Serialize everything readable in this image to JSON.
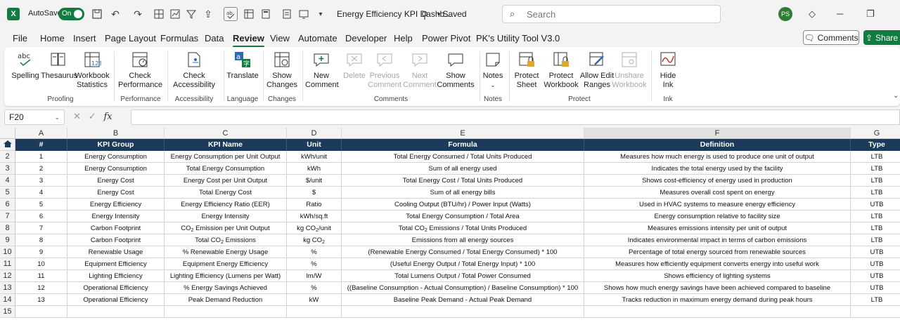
{
  "titlebar": {
    "app_logo": "X",
    "autosave_label": "AutoSave",
    "autosave_state": "On",
    "doc_title": "Energy Efficiency KPI Dashb...",
    "saved_status": "• Saved",
    "search_placeholder": "Search",
    "user_initials": "PS"
  },
  "menu": {
    "tabs": [
      "File",
      "Home",
      "Insert",
      "Page Layout",
      "Formulas",
      "Data",
      "Review",
      "View",
      "Automate",
      "Developer",
      "Help",
      "Power Pivot",
      "PK's Utility Tool V3.0"
    ],
    "active_tab": "Review",
    "comments_label": "Comments",
    "share_label": "Share"
  },
  "ribbon": {
    "buttons": [
      {
        "label": "Spelling",
        "icon": "abc-check-icon"
      },
      {
        "label": "Thesaurus",
        "icon": "book-icon"
      },
      {
        "label": "Workbook Statistics",
        "icon": "statistics-icon"
      },
      {
        "label": "Check Performance",
        "icon": "performance-icon"
      },
      {
        "label": "Check Accessibility",
        "icon": "accessibility-icon"
      },
      {
        "label": "Translate",
        "icon": "translate-icon"
      },
      {
        "label": "Show Changes",
        "icon": "show-changes-icon"
      },
      {
        "label": "New Comment",
        "icon": "new-comment-icon"
      },
      {
        "label": "Delete",
        "icon": "delete-comment-icon"
      },
      {
        "label": "Previous Comment",
        "icon": "previous-comment-icon"
      },
      {
        "label": "Next Comment",
        "icon": "next-comment-icon"
      },
      {
        "label": "Show Comments",
        "icon": "show-comments-icon"
      },
      {
        "label": "Notes",
        "icon": "notes-icon"
      },
      {
        "label": "Protect Sheet",
        "icon": "protect-sheet-icon"
      },
      {
        "label": "Protect Workbook",
        "icon": "protect-workbook-icon"
      },
      {
        "label": "Allow Edit Ranges",
        "icon": "allow-edit-icon"
      },
      {
        "label": "Unshare Workbook",
        "icon": "unshare-icon"
      },
      {
        "label": "Hide Ink",
        "icon": "ink-icon"
      }
    ],
    "groups": [
      "Proofing",
      "Performance",
      "Accessibility",
      "Language",
      "Changes",
      "Comments",
      "Notes",
      "Protect",
      "Ink"
    ]
  },
  "formula_bar": {
    "name_box": "F20",
    "fx_label": "fx",
    "formula": ""
  },
  "sheet": {
    "column_letters": [
      "A",
      "B",
      "C",
      "D",
      "E",
      "F",
      "G"
    ],
    "selected_column": "F",
    "row_numbers": [
      "1",
      "2",
      "3",
      "4",
      "5",
      "6",
      "7",
      "8",
      "9",
      "10",
      "11",
      "12",
      "13",
      "14",
      "15"
    ],
    "headers": [
      "#",
      "KPI Group",
      "KPI Name",
      "Unit",
      "Formula",
      "Definition",
      "Type"
    ],
    "rows": [
      [
        "1",
        "Energy Consumption",
        "Energy Consumption per Unit Output",
        "kWh/unit",
        "Total Energy Consumed / Total Units Produced",
        "Measures how much energy is used to produce one unit of output",
        "LTB"
      ],
      [
        "2",
        "Energy Consumption",
        "Total Energy Consumption",
        "kWh",
        "Sum of all energy used",
        "Indicates the total energy used by the facility",
        "LTB"
      ],
      [
        "3",
        "Energy Cost",
        "Energy Cost per Unit Output",
        "$/unit",
        "Total Energy Cost / Total Units Produced",
        "Shows cost-efficiency of energy used in production",
        "LTB"
      ],
      [
        "4",
        "Energy Cost",
        "Total Energy Cost",
        "$",
        "Sum of all energy bills",
        "Measures overall cost spent on energy",
        "LTB"
      ],
      [
        "5",
        "Energy Efficiency",
        "Energy Efficiency Ratio (EER)",
        "Ratio",
        "Cooling Output (BTU/hr) / Power Input (Watts)",
        "Used in HVAC systems to measure energy efficiency",
        "UTB"
      ],
      [
        "6",
        "Energy Intensity",
        "Energy Intensity",
        "kWh/sq.ft",
        "Total Energy Consumption / Total Area",
        "Energy consumption relative to facility size",
        "LTB"
      ],
      [
        "7",
        "Carbon Footprint",
        "CO₂ Emission per Unit Output",
        "kg CO₂/unit",
        "Total CO₂ Emissions / Total Units Produced",
        "Measures emissions intensity per unit of output",
        "LTB"
      ],
      [
        "8",
        "Carbon Footprint",
        "Total CO₂ Emissions",
        "kg CO₂",
        "Emissions from all energy sources",
        "Indicates environmental impact in terms of carbon emissions",
        "LTB"
      ],
      [
        "9",
        "Renewable Usage",
        "% Renewable Energy Usage",
        "%",
        "(Renewable Energy Consumed / Total Energy Consumed) * 100",
        "Percentage of total energy sourced from renewable sources",
        "UTB"
      ],
      [
        "10",
        "Equipment Efficiency",
        "Equipment Energy Efficiency",
        "%",
        "(Useful Energy Output / Total Energy Input) * 100",
        "Measures how efficiently equipment converts energy into useful work",
        "UTB"
      ],
      [
        "11",
        "Lighting Efficiency",
        "Lighting Efficiency (Lumens per Watt)",
        "lm/W",
        "Total Lumens Output / Total Power Consumed",
        "Shows efficiency of lighting systems",
        "UTB"
      ],
      [
        "12",
        "Operational Efficiency",
        "% Energy Savings Achieved",
        "%",
        "((Baseline Consumption - Actual Consumption) / Baseline Consumption) * 100",
        "Shows how much energy savings have been achieved compared to baseline",
        "UTB"
      ],
      [
        "13",
        "Operational Efficiency",
        "Peak Demand Reduction",
        "kW",
        "Baseline Peak Demand - Actual Peak Demand",
        "Tracks reduction in maximum energy demand during peak hours",
        "LTB"
      ]
    ]
  },
  "colors": {
    "accent": "#107c41",
    "header_fill": "#1b3a5c"
  }
}
